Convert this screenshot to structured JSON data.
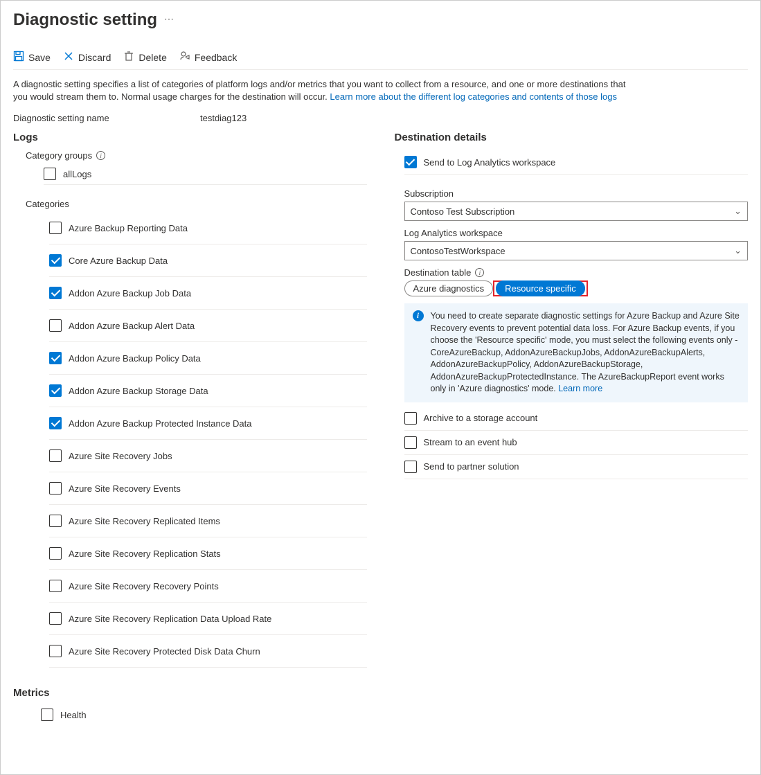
{
  "header": {
    "title": "Diagnostic setting"
  },
  "toolbar": {
    "save": "Save",
    "discard": "Discard",
    "delete": "Delete",
    "feedback": "Feedback"
  },
  "description": {
    "text": "A diagnostic setting specifies a list of categories of platform logs and/or metrics that you want to collect from a resource, and one or more destinations that you would stream them to. Normal usage charges for the destination will occur. ",
    "link": "Learn more about the different log categories and contents of those logs"
  },
  "name_field": {
    "label": "Diagnostic setting name",
    "value": "testdiag123"
  },
  "logs": {
    "title": "Logs",
    "category_groups_label": "Category groups",
    "all_logs": {
      "label": "allLogs",
      "checked": false
    },
    "categories_label": "Categories",
    "categories": [
      {
        "label": "Azure Backup Reporting Data",
        "checked": false
      },
      {
        "label": "Core Azure Backup Data",
        "checked": true
      },
      {
        "label": "Addon Azure Backup Job Data",
        "checked": true
      },
      {
        "label": "Addon Azure Backup Alert Data",
        "checked": false
      },
      {
        "label": "Addon Azure Backup Policy Data",
        "checked": true
      },
      {
        "label": "Addon Azure Backup Storage Data",
        "checked": true
      },
      {
        "label": "Addon Azure Backup Protected Instance Data",
        "checked": true
      },
      {
        "label": "Azure Site Recovery Jobs",
        "checked": false
      },
      {
        "label": "Azure Site Recovery Events",
        "checked": false
      },
      {
        "label": "Azure Site Recovery Replicated Items",
        "checked": false
      },
      {
        "label": "Azure Site Recovery Replication Stats",
        "checked": false
      },
      {
        "label": "Azure Site Recovery Recovery Points",
        "checked": false
      },
      {
        "label": "Azure Site Recovery Replication Data Upload Rate",
        "checked": false
      },
      {
        "label": "Azure Site Recovery Protected Disk Data Churn",
        "checked": false
      }
    ]
  },
  "metrics": {
    "title": "Metrics",
    "items": [
      {
        "label": "Health",
        "checked": false
      }
    ]
  },
  "destination": {
    "title": "Destination details",
    "send_la": {
      "label": "Send to Log Analytics workspace",
      "checked": true
    },
    "subscription": {
      "label": "Subscription",
      "value": "Contoso Test Subscription"
    },
    "workspace": {
      "label": "Log Analytics workspace",
      "value": "ContosoTestWorkspace"
    },
    "dest_table": {
      "label": "Destination table",
      "option_a": "Azure diagnostics",
      "option_b": "Resource specific",
      "selected": "b"
    },
    "info": {
      "text": "You need to create separate diagnostic settings for Azure Backup and Azure Site Recovery events to prevent potential data loss. For Azure Backup events, if you choose the 'Resource specific' mode, you must select the following events only - CoreAzureBackup, AddonAzureBackupJobs, AddonAzureBackupAlerts, AddonAzureBackupPolicy, AddonAzureBackupStorage, AddonAzureBackupProtectedInstance. The AzureBackupReport event works only in 'Azure diagnostics' mode.  ",
      "link": "Learn more"
    },
    "archive": {
      "label": "Archive to a storage account",
      "checked": false
    },
    "eventhub": {
      "label": "Stream to an event hub",
      "checked": false
    },
    "partner": {
      "label": "Send to partner solution",
      "checked": false
    }
  }
}
